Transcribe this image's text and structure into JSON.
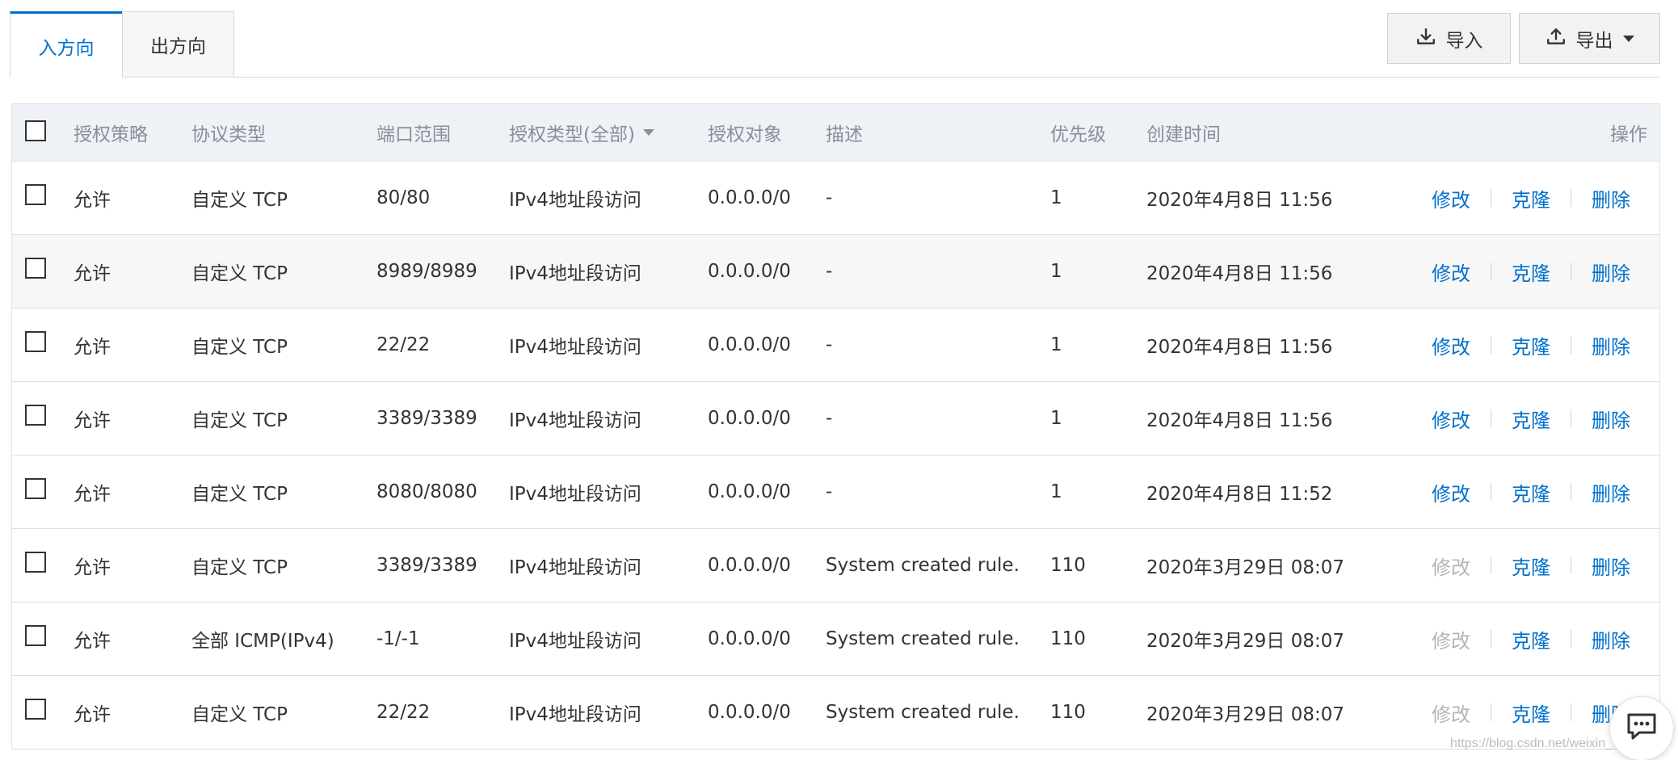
{
  "tabs": [
    {
      "label": "入方向",
      "active": true
    },
    {
      "label": "出方向",
      "active": false
    }
  ],
  "toolbar": {
    "import_label": "导入",
    "export_label": "导出"
  },
  "table": {
    "headers": {
      "policy": "授权策略",
      "protocol": "协议类型",
      "port": "端口范围",
      "auth_type": "授权类型(全部)",
      "object": "授权对象",
      "description": "描述",
      "priority": "优先级",
      "created": "创建时间",
      "actions": "操作"
    },
    "rows": [
      {
        "policy": "允许",
        "protocol": "自定义 TCP",
        "port": "80/80",
        "auth_type": "IPv4地址段访问",
        "object": "0.0.0.0/0",
        "description": "-",
        "priority": "1",
        "created": "2020年4月8日 11:56",
        "edit_enabled": true
      },
      {
        "policy": "允许",
        "protocol": "自定义 TCP",
        "port": "8989/8989",
        "auth_type": "IPv4地址段访问",
        "object": "0.0.0.0/0",
        "description": "-",
        "priority": "1",
        "created": "2020年4月8日 11:56",
        "edit_enabled": true
      },
      {
        "policy": "允许",
        "protocol": "自定义 TCP",
        "port": "22/22",
        "auth_type": "IPv4地址段访问",
        "object": "0.0.0.0/0",
        "description": "-",
        "priority": "1",
        "created": "2020年4月8日 11:56",
        "edit_enabled": true
      },
      {
        "policy": "允许",
        "protocol": "自定义 TCP",
        "port": "3389/3389",
        "auth_type": "IPv4地址段访问",
        "object": "0.0.0.0/0",
        "description": "-",
        "priority": "1",
        "created": "2020年4月8日 11:56",
        "edit_enabled": true
      },
      {
        "policy": "允许",
        "protocol": "自定义 TCP",
        "port": "8080/8080",
        "auth_type": "IPv4地址段访问",
        "object": "0.0.0.0/0",
        "description": "-",
        "priority": "1",
        "created": "2020年4月8日 11:52",
        "edit_enabled": true
      },
      {
        "policy": "允许",
        "protocol": "自定义 TCP",
        "port": "3389/3389",
        "auth_type": "IPv4地址段访问",
        "object": "0.0.0.0/0",
        "description": "System created rule.",
        "priority": "110",
        "created": "2020年3月29日 08:07",
        "edit_enabled": false
      },
      {
        "policy": "允许",
        "protocol": "全部 ICMP(IPv4)",
        "port": "-1/-1",
        "auth_type": "IPv4地址段访问",
        "object": "0.0.0.0/0",
        "description": "System created rule.",
        "priority": "110",
        "created": "2020年3月29日 08:07",
        "edit_enabled": false
      },
      {
        "policy": "允许",
        "protocol": "自定义 TCP",
        "port": "22/22",
        "auth_type": "IPv4地址段访问",
        "object": "0.0.0.0/0",
        "description": "System created rule.",
        "priority": "110",
        "created": "2020年3月29日 08:07",
        "edit_enabled": false
      }
    ],
    "actions": {
      "edit": "修改",
      "clone": "克隆",
      "delete": "删除"
    }
  },
  "watermark": "https://blog.csdn.net/weixin_",
  "colors": {
    "accent": "#0070cc",
    "disabled": "#b5b5b5",
    "header_bg": "#eef1f6",
    "header_text": "#8a8e99"
  }
}
